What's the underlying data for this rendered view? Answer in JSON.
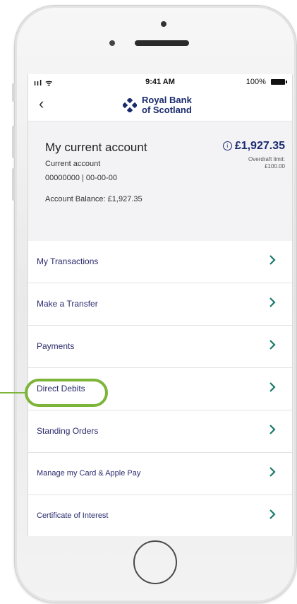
{
  "status_bar": {
    "signal": "ııl ᯤ",
    "time": "9:41 AM",
    "battery": "100%"
  },
  "nav": {
    "back": "‹",
    "brand_line1": "Royal Bank",
    "brand_line2": "of Scotland"
  },
  "account": {
    "title": "My current account",
    "type": "Current account",
    "number": "00000000 | 00-00-00",
    "balance_label": "Account Balance: £1,927.35",
    "amount": "£1,927.35",
    "overdraft_label": "Overdraft limit:",
    "overdraft_value": "£100.00"
  },
  "menu": {
    "items": [
      {
        "label": "My Transactions"
      },
      {
        "label": "Make a Transfer"
      },
      {
        "label": "Payments"
      },
      {
        "label": "Direct Debits"
      },
      {
        "label": "Standing Orders"
      },
      {
        "label": "Manage my Card & Apple Pay"
      },
      {
        "label": "Certificate of Interest"
      }
    ]
  },
  "colors": {
    "brand": "#1a2b6d",
    "highlight": "#7db43a",
    "chevron": "#1a7a6a"
  },
  "icons": [
    "signal-icon",
    "wifi-icon",
    "battery-icon",
    "back-chevron-icon",
    "rbs-logo-icon",
    "info-icon",
    "chevron-right-icon",
    "home-button"
  ]
}
